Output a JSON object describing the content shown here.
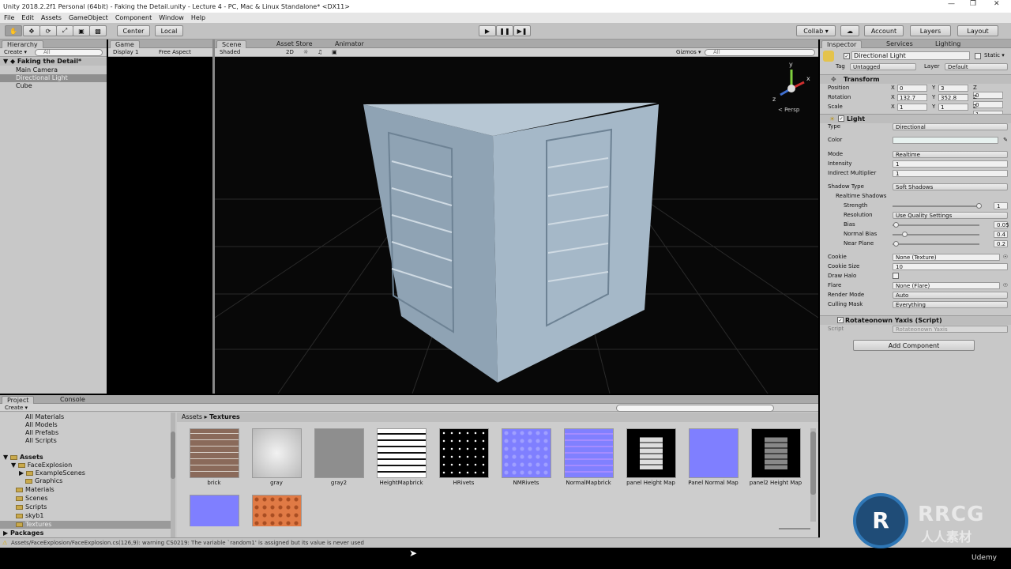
{
  "window": {
    "title": "Unity 2018.2.2f1 Personal (64bit) - Faking the Detail.unity - Lecture 4 - PC, Mac & Linux Standalone* <DX11>"
  },
  "menu": [
    "File",
    "Edit",
    "Assets",
    "GameObject",
    "Component",
    "Window",
    "Help"
  ],
  "toolbar": {
    "center": "Center",
    "local": "Local",
    "collab": "Collab ▾",
    "account": "Account",
    "layers": "Layers",
    "layout": "Layout"
  },
  "hierarchy": {
    "tab": "Hierarchy",
    "create": "Create ▾",
    "search": "All",
    "scene": "Faking the Detail*",
    "items": [
      "Main Camera",
      "Directional Light",
      "Cube"
    ]
  },
  "game": {
    "tab": "Game",
    "display": "Display 1",
    "aspect": "Free Aspect"
  },
  "scene_view": {
    "tabs": [
      "Scene",
      "Asset Store",
      "Animator"
    ],
    "shaded": "Shaded",
    "mode2d": "2D",
    "gizmos": "Gizmos ▾",
    "search": "All",
    "persp": "< Persp",
    "gizmo_axes": [
      "y",
      "x",
      "z"
    ]
  },
  "inspector": {
    "tabs": [
      "Inspector",
      "Services",
      "Lighting"
    ],
    "object_name": "Directional Light",
    "static": "Static ▾",
    "tag_label": "Tag",
    "tag": "Untagged",
    "layer_label": "Layer",
    "layer": "Default",
    "transform": {
      "title": "Transform",
      "rows": [
        {
          "label": "Position",
          "x": "0",
          "y": "3",
          "z": "0"
        },
        {
          "label": "Rotation",
          "x": "132.7",
          "y": "352.8",
          "z": "0"
        },
        {
          "label": "Scale",
          "x": "1",
          "y": "1",
          "z": "1"
        }
      ]
    },
    "light": {
      "title": "Light",
      "type_label": "Type",
      "type": "Directional",
      "color_label": "Color",
      "mode_label": "Mode",
      "mode": "Realtime",
      "intensity_label": "Intensity",
      "intensity": "1",
      "indirect_label": "Indirect Multiplier",
      "indirect": "1",
      "shadow_label": "Shadow Type",
      "shadow": "Soft Shadows",
      "rt_shadows": "Realtime Shadows",
      "strength_label": "Strength",
      "strength": "1",
      "resolution_label": "Resolution",
      "resolution": "Use Quality Settings",
      "bias_label": "Bias",
      "bias": "0.05",
      "normal_bias_label": "Normal Bias",
      "normal_bias": "0.4",
      "near_label": "Near Plane",
      "near": "0.2",
      "cookie_label": "Cookie",
      "cookie": "None (Texture)",
      "cookie_size_label": "Cookie Size",
      "cookie_size": "10",
      "halo_label": "Draw Halo",
      "flare_label": "Flare",
      "flare": "None (Flare)",
      "render_label": "Render Mode",
      "render": "Auto",
      "culling_label": "Culling Mask",
      "culling": "Everything"
    },
    "script_comp": {
      "title": "Rotateonown Yaxis (Script)",
      "script_label": "Script",
      "script": "Rotateonown Yaxis"
    },
    "add_component": "Add Component"
  },
  "project": {
    "tabs": [
      "Project",
      "Console"
    ],
    "create": "Create ▾",
    "favorites": [
      "All Materials",
      "All Models",
      "All Prefabs",
      "All Scripts"
    ],
    "assets_root": "Assets",
    "tree": [
      "FaceExplosion",
      "ExampleScenes",
      "Graphics",
      "Materials",
      "Scenes",
      "Scripts",
      "skyb1",
      "Textures"
    ],
    "packages": "Packages",
    "breadcrumb": [
      "Assets",
      "Textures"
    ],
    "assets": [
      "brick",
      "gray",
      "gray2",
      "HeightMapbrick",
      "HRivets",
      "NMRivets",
      "NormalMapbrick",
      "panel Height Map",
      "Panel Normal Map",
      "panel2 Height Map"
    ]
  },
  "status": {
    "message": "Assets/FaceExplosion/FaceExplosion.cs(126,9): warning CS0219: The variable `random1' is assigned but its value is never used"
  },
  "watermark": {
    "brand": "RRCG",
    "sub": "人人素材",
    "udemy": "Udemy"
  },
  "colors": {
    "panel": "#c8c8c8",
    "scene_bg": "#080808",
    "selection": "#8f8f8f",
    "logo_blue": "#1f6fb5"
  }
}
